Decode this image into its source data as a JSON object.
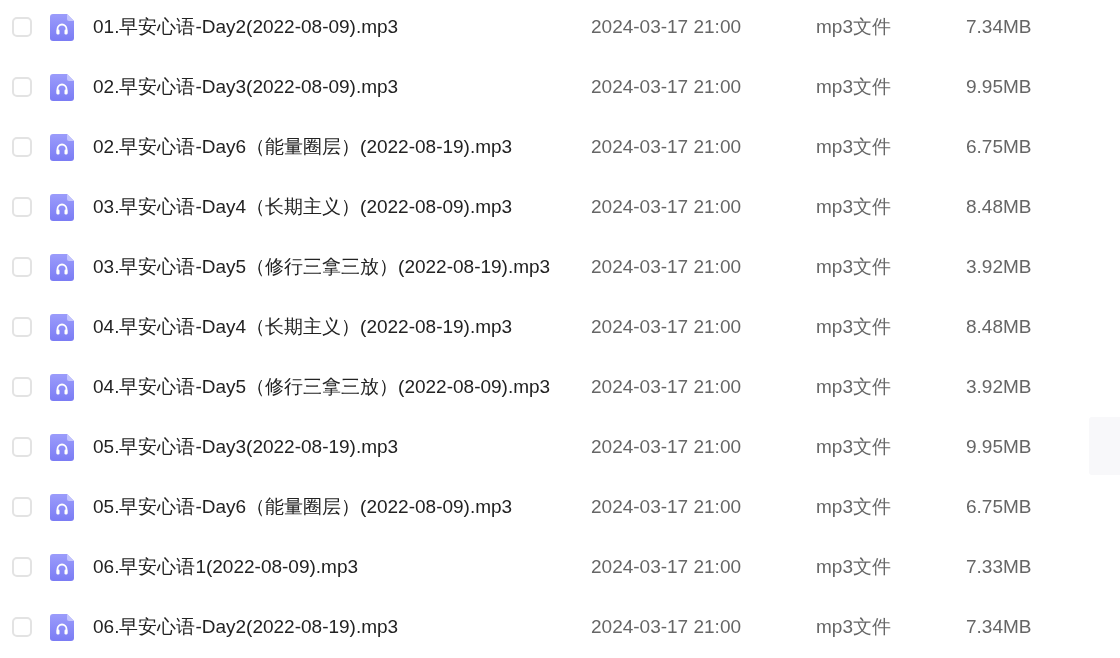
{
  "files": [
    {
      "checked": false,
      "name": "01.早安心语-Day2(2022-08-09).mp3",
      "modified": "2024-03-17 21:00",
      "type": "mp3文件",
      "size": "7.34MB"
    },
    {
      "checked": false,
      "name": "02.早安心语-Day3(2022-08-09).mp3",
      "modified": "2024-03-17 21:00",
      "type": "mp3文件",
      "size": "9.95MB"
    },
    {
      "checked": false,
      "name": "02.早安心语-Day6（能量圈层）(2022-08-19).mp3",
      "modified": "2024-03-17 21:00",
      "type": "mp3文件",
      "size": "6.75MB"
    },
    {
      "checked": false,
      "name": "03.早安心语-Day4（长期主义）(2022-08-09).mp3",
      "modified": "2024-03-17 21:00",
      "type": "mp3文件",
      "size": "8.48MB"
    },
    {
      "checked": false,
      "name": "03.早安心语-Day5（修行三拿三放）(2022-08-19).mp3",
      "modified": "2024-03-17 21:00",
      "type": "mp3文件",
      "size": "3.92MB"
    },
    {
      "checked": false,
      "name": "04.早安心语-Day4（长期主义）(2022-08-19).mp3",
      "modified": "2024-03-17 21:00",
      "type": "mp3文件",
      "size": "8.48MB"
    },
    {
      "checked": false,
      "name": "04.早安心语-Day5（修行三拿三放）(2022-08-09).mp3",
      "modified": "2024-03-17 21:00",
      "type": "mp3文件",
      "size": "3.92MB"
    },
    {
      "checked": false,
      "name": "05.早安心语-Day3(2022-08-19).mp3",
      "modified": "2024-03-17 21:00",
      "type": "mp3文件",
      "size": "9.95MB"
    },
    {
      "checked": false,
      "name": "05.早安心语-Day6（能量圈层）(2022-08-09).mp3",
      "modified": "2024-03-17 21:00",
      "type": "mp3文件",
      "size": "6.75MB"
    },
    {
      "checked": false,
      "name": "06.早安心语1(2022-08-09).mp3",
      "modified": "2024-03-17 21:00",
      "type": "mp3文件",
      "size": "7.33MB"
    },
    {
      "checked": false,
      "name": "06.早安心语-Day2(2022-08-19).mp3",
      "modified": "2024-03-17 21:00",
      "type": "mp3文件",
      "size": "7.34MB"
    }
  ]
}
